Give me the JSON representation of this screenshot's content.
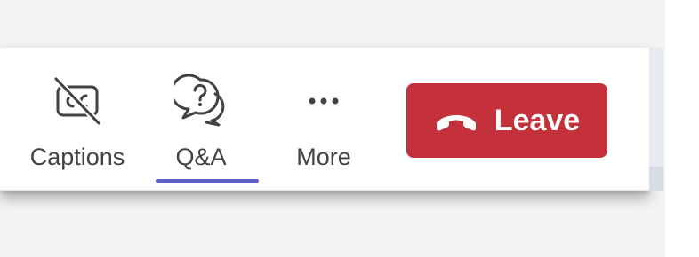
{
  "toolbar": {
    "captions": {
      "label": "Captions",
      "icon": "closed-captions-off-icon"
    },
    "qa": {
      "label": "Q&A",
      "icon": "question-chat-icon",
      "active": true
    },
    "more": {
      "label": "More",
      "icon": "more-dots-icon"
    },
    "leave": {
      "label": "Leave",
      "icon": "hang-up-phone-icon"
    }
  },
  "colors": {
    "leave_bg": "#c4313a",
    "active_underline": "#5b5fc7",
    "label_text": "#424242"
  }
}
